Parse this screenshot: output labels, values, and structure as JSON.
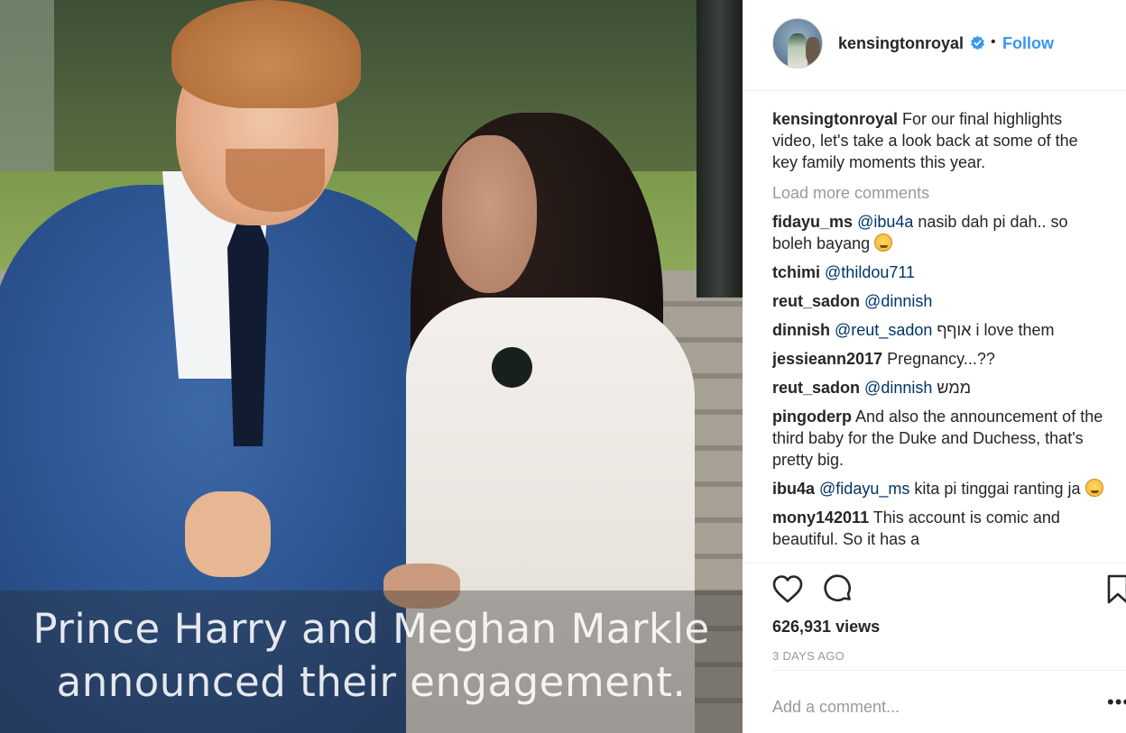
{
  "media": {
    "caption_line1": "Prince Harry and Meghan Markle",
    "caption_line2": "announced their engagement."
  },
  "header": {
    "username": "kensingtonroyal",
    "separator": "•",
    "follow_label": "Follow"
  },
  "caption": {
    "username": "kensingtonroyal",
    "text": "For our final highlights video, let's take a look back at some of the key family moments this year."
  },
  "load_more_label": "Load more comments",
  "comments": [
    {
      "user": "fidayu_ms",
      "mention": "@ibu4a",
      "text": "nasib dah pi dah.. so boleh bayang",
      "emoji": "smile-emoji"
    },
    {
      "user": "tchimi",
      "mention": "@thildou711",
      "text": ""
    },
    {
      "user": "reut_sadon",
      "mention": "@dinnish",
      "text": ""
    },
    {
      "user": "dinnish",
      "mention": "@reut_sadon",
      "text": "אוףף i love them"
    },
    {
      "user": "jessieann2017",
      "mention": "",
      "text": "Pregnancy...??"
    },
    {
      "user": "reut_sadon",
      "mention": "@dinnish",
      "text": "ממש"
    },
    {
      "user": "pingoderp",
      "mention": "",
      "text": "And also the announcement of the third baby for the Duke and Duchess, that's pretty big."
    },
    {
      "user": "ibu4a",
      "mention": "@fidayu_ms",
      "text": "kita pi tinggai ranting ja",
      "emoji": "crying-laugh-emoji"
    },
    {
      "user": "mony142011",
      "mention": "",
      "text": " This account is comic and beautiful. So it has a"
    }
  ],
  "actions": {
    "like_icon": "heart-icon",
    "comment_icon": "comment-icon",
    "save_icon": "bookmark-icon"
  },
  "views": "626,931 views",
  "timestamp": "3 DAYS AGO",
  "add_comment_placeholder": "Add a comment...",
  "more_options": "•••",
  "colors": {
    "link_blue": "#3897f0",
    "mention_blue": "#003569",
    "muted_gray": "#999999",
    "text": "#262626"
  }
}
